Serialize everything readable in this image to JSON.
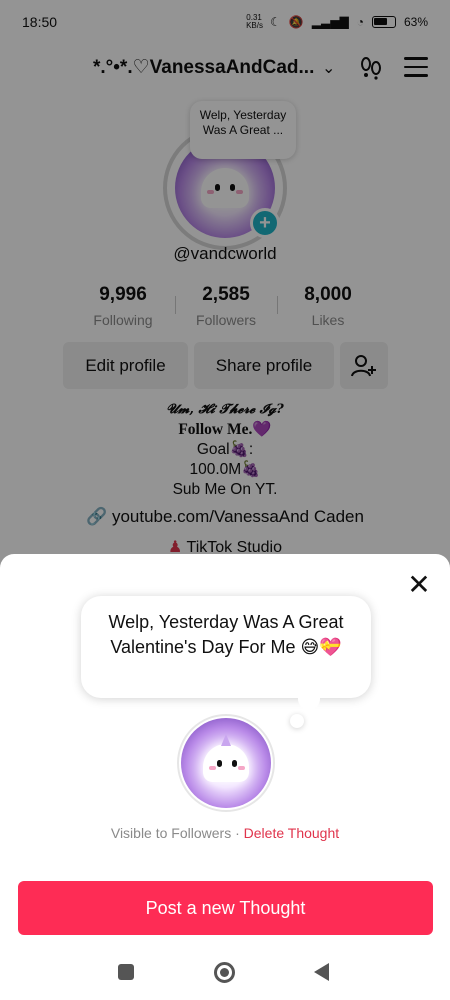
{
  "status_bar": {
    "time": "18:50",
    "network_speed": "0.31 KB/s",
    "battery": "63%"
  },
  "profile": {
    "username": "*.°•*.♡VanessaAndCad...",
    "handle": "@vandcworld",
    "bubble_preview": "Welp, Yesterday Was A Great ...",
    "stats": [
      {
        "value": "9,996",
        "label": "Following"
      },
      {
        "value": "2,585",
        "label": "Followers"
      },
      {
        "value": "8,000",
        "label": "Likes"
      }
    ],
    "buttons": {
      "edit": "Edit profile",
      "share": "Share profile"
    },
    "bio": {
      "line1": "𝓤𝓶, 𝓗𝓲 𝓣𝓱𝓮𝓻𝓮 𝓘𝓰?",
      "line2": "Follow Me.💜",
      "line3": "Goal🍇:",
      "line4": "100.0M🍇",
      "line5": "Sub Me On YT."
    },
    "link": "youtube.com/VanessaAnd Caden",
    "studio": "TikTok Studio"
  },
  "sheet": {
    "thought_text": "Welp, Yesterday Was A Great Valentine's Day For Me 😅💝",
    "visibility": "Visible to Followers · ",
    "delete_label": "Delete Thought",
    "post_button": "Post a new Thought"
  },
  "colors": {
    "accent": "#fe2c55",
    "delete": "#e0344c",
    "badge": "#20b3c7"
  }
}
